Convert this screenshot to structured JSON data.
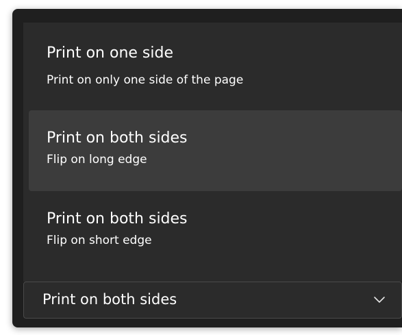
{
  "menu": {
    "items": [
      {
        "title": "Print on one side",
        "subtitle": "Print on only one side of the page",
        "selected": false
      },
      {
        "title": "Print on both sides",
        "subtitle": "Flip on long edge",
        "selected": true
      },
      {
        "title": "Print on both sides",
        "subtitle": "Flip on short edge",
        "selected": false
      }
    ]
  },
  "select": {
    "value": "Print on both sides",
    "icon": "chevron-down-icon"
  },
  "colors": {
    "panel_bg": "#1f1f1f",
    "menu_bg": "#2b2b2b",
    "selected_bg": "#3c3c3c",
    "text": "#ffffff"
  }
}
